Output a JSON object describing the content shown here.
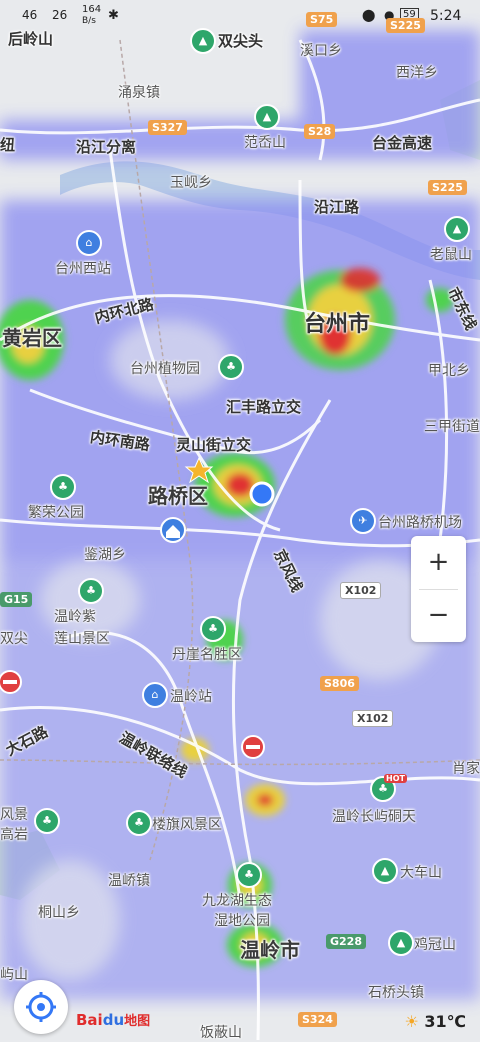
{
  "status_bar": {
    "network_left": "46",
    "network_right": "26",
    "speed": "164",
    "speed_unit": "B/s",
    "battery": "59",
    "time": "5:24"
  },
  "places": {
    "houling": "后岭山",
    "shuangjian": "双尖头",
    "xikou": "溪口乡",
    "xiyang": "西洋乡",
    "yongquan": "涌泉镇",
    "yanjiang_fenli": "沿江分离",
    "fanxiang": "范岙山",
    "taijin": "台金高速",
    "niu": "纽",
    "yuxian": "玉岘乡",
    "yanjiang_road": "沿江路",
    "taizhou_west": "台州西站",
    "laoshu": "老鼠山",
    "huangyan": "黄岩区",
    "neihuan_north": "内环北路",
    "taizhou_city": "台州市",
    "shi_dong": "市东线",
    "botanical": "台州植物园",
    "jiabei": "甲北乡",
    "huifeng": "汇丰路立交",
    "sanjia": "三甲街道",
    "neihuan_south": "内环南路",
    "lingshan": "灵山街立交",
    "luqiao": "路桥区",
    "fanrong": "繁荣公园",
    "airport": "台州路桥机场",
    "jianhu": "鉴湖乡",
    "jingfeng": "京风线",
    "wenling_zi": "温岭紫",
    "lianshan": "莲山景区",
    "shuang_jian": "双尖",
    "danya": "丹崖名胜区",
    "wenling_station": "温岭站",
    "dashi": "大石路",
    "wenling_lianluo": "温岭联络线",
    "xiaoxiao": "肖家",
    "fengjing": "风景",
    "gaoyan": "高岩",
    "louqi": "楼旗风景区",
    "changyu": "温岭长屿硐天",
    "wenqiao": "温峤镇",
    "dache": "大车山",
    "jiulong": "九龙湖生态",
    "shidi": "湿地公园",
    "tongshan": "桐山乡",
    "jiguan": "鸡冠山",
    "wenling_city": "温岭市",
    "shiqiaotou": "石桥头镇",
    "yu_shan": "屿山",
    "feng_shan": "饭蔽山"
  },
  "shields": {
    "s75": "S75",
    "s225a": "S225",
    "s327": "S327",
    "s28": "S28",
    "s225b": "S225",
    "g15": "G15",
    "x102a": "X102",
    "s806": "S806",
    "x102b": "X102",
    "g228": "G228",
    "s324": "S324"
  },
  "controls": {
    "zoom_in": "+",
    "zoom_out": "−",
    "logo_bai": "Bai",
    "logo_du": "du",
    "logo_map": "地图",
    "hot_badge": "HOT"
  },
  "weather": {
    "temperature": "31℃"
  },
  "colors": {
    "water": "#b7cbe6",
    "road": "#ffffff",
    "heat_low": "#7c7cf0",
    "heat_mid": "#4fd24f",
    "heat_high": "#e8d040",
    "heat_peak": "#e03030",
    "user_location": "#3478f6"
  }
}
